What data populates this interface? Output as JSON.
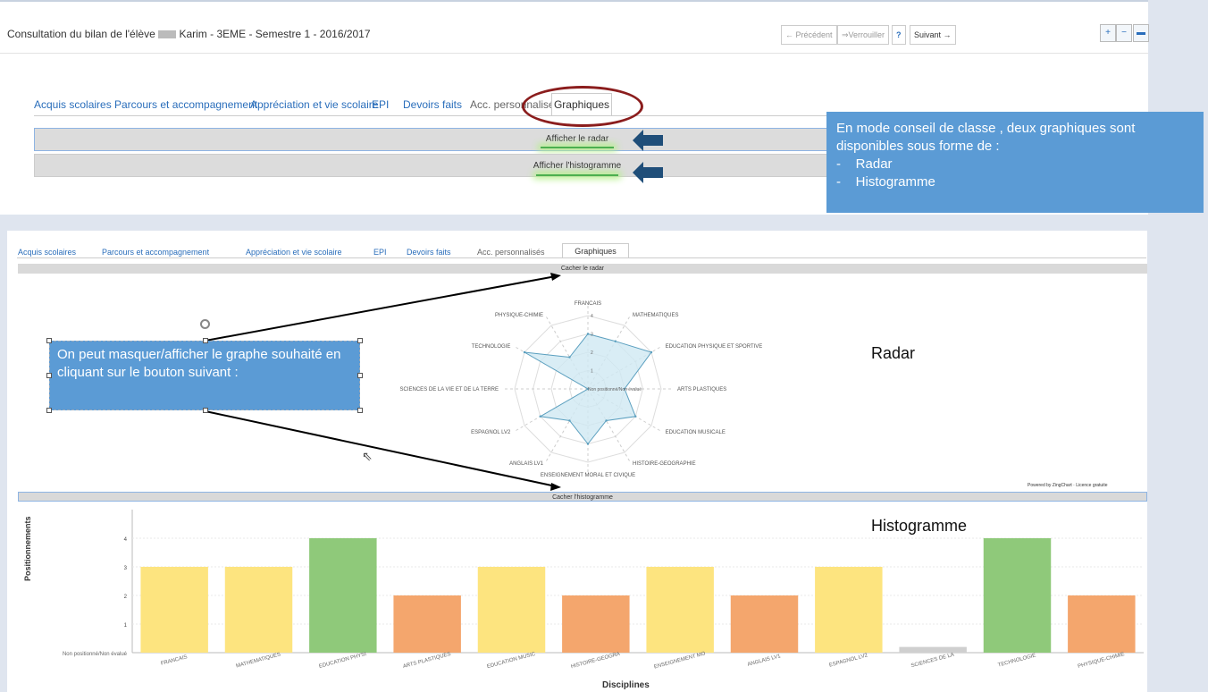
{
  "header": {
    "title": "Consultation du bilan de l'élève",
    "student_name": "Karim - 3EME - Semestre 1 - 2016/2017",
    "prev_label": "← Précédent",
    "lock_label": "⇒Verrouiller",
    "help_label": "?",
    "next_label": "Suivant →",
    "zoom_in": "🔍",
    "zoom_out": "🔍",
    "minimize": "–"
  },
  "tabs": [
    "Acquis scolaires",
    "Parcours et accompagnement",
    "Appréciation et vie scolaire",
    "EPI",
    "Devoirs faits",
    "Acc. personnalisés",
    "Graphiques"
  ],
  "top_buttons": {
    "show_radar": "Afficher le radar",
    "show_hist": "Afficher l'histogramme"
  },
  "callout_top": {
    "line1": "En mode conseil de classe , deux graphiques sont",
    "line2": "disponibles sous forme de :",
    "item1": "Radar",
    "item2": "Histogramme",
    "bullet": "-"
  },
  "bottom_buttons": {
    "hide_radar": "Cacher le radar",
    "hide_hist": "Cacher l'histogramme"
  },
  "callout_bottom": {
    "text": "On peut masquer/afficher le graphe souhaité en cliquant sur le bouton suivant  :"
  },
  "labels": {
    "radar": "Radar",
    "histogram": "Histogramme",
    "powered": "Powered by ZingChart · Licence gratuite",
    "non_positioned": "Non positionné/Non évalué"
  },
  "colors": {
    "accent": "#2a6ebb",
    "callout": "#5b9bd5",
    "ellipse": "#8b1d1d",
    "arrow": "#1f4e79",
    "yellow": "#fde47f",
    "green": "#8fc97a",
    "orange": "#f4a66d",
    "grey": "#cfcfcf"
  },
  "chart_data": [
    {
      "type": "radar",
      "categories": [
        "FRANCAIS",
        "MATHEMATIQUES",
        "EDUCATION PHYSIQUE ET SPORTIVE",
        "ARTS PLASTIQUES",
        "EDUCATION MUSICALE",
        "HISTOIRE-GEOGRAPHIE",
        "ENSEIGNEMENT MORAL ET CIVIQUE",
        "ANGLAIS LV1",
        "ESPAGNOL LV2",
        "SCIENCES DE LA VIE ET DE LA TERRE",
        "TECHNOLOGIE",
        "PHYSIQUE-CHIMIE"
      ],
      "values": [
        3,
        3,
        4,
        2,
        3,
        2,
        3,
        2,
        3,
        0,
        4,
        2
      ],
      "rlim": [
        0,
        4
      ],
      "ticks": [
        "1",
        "2",
        "3",
        "4"
      ],
      "center_label": "Non positionné/Non évalué"
    },
    {
      "type": "bar",
      "categories": [
        "FRANCAIS",
        "MATHEMATIQUES",
        "EDUCATION PHYSI",
        "ARTS PLASTIQUES",
        "EDUCATION MUSIC",
        "HISTOIRE-GEOGRA",
        "ENSEIGNEMENT MO",
        "ANGLAIS LV1",
        "ESPAGNOL LV2",
        "SCIENCES DE LA",
        "TECHNOLOGIE",
        "PHYSIQUE-CHIMIE"
      ],
      "values": [
        3,
        3,
        4,
        2,
        3,
        2,
        3,
        2,
        3,
        0.2,
        4,
        2
      ],
      "ylim": [
        0,
        5
      ],
      "yticks": [
        "Non positionné/Non évalué",
        "1",
        "2",
        "3",
        "4"
      ],
      "ylabel": "Positionnements",
      "xlabel": "Disciplines"
    }
  ]
}
